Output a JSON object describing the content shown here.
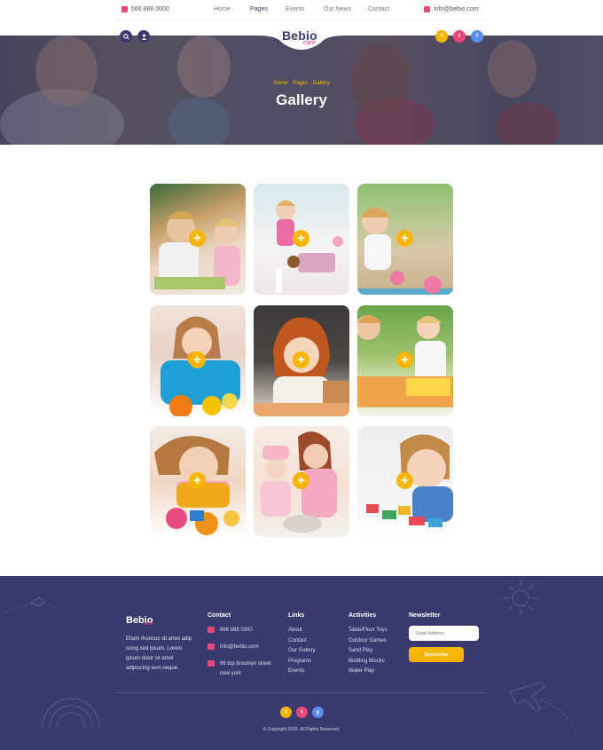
{
  "topbar": {
    "phone": "666 888 0000",
    "email": "info@bebio.com",
    "nav": [
      "Home",
      "Pages",
      "Events",
      "Our News",
      "Contact"
    ],
    "active_nav": "Pages"
  },
  "brand": {
    "name": "Bebio",
    "tag": "care"
  },
  "hero": {
    "breadcrumb": [
      "Home",
      "Pages",
      "Gallery"
    ],
    "title": "Gallery"
  },
  "header_socials": [
    "f",
    "t",
    "f"
  ],
  "gallery": {
    "plus_label": "+",
    "items": [
      {
        "subject": "boys-playing-table"
      },
      {
        "subject": "girl-with-toys"
      },
      {
        "subject": "child-in-sandbox"
      },
      {
        "subject": "girl-with-fruit"
      },
      {
        "subject": "girl-redhair-drawing"
      },
      {
        "subject": "boy-painting-outdoors"
      },
      {
        "subject": "girl-playdough"
      },
      {
        "subject": "mother-cooking-with-child"
      },
      {
        "subject": "boy-building-blocks"
      }
    ]
  },
  "footer": {
    "about": "Etiam rhoncus sit amet adip scing sed ipsum. Lorem ipsum dolor sit amet adipiscing sem neque.",
    "contact": {
      "title": "Contact",
      "phone": "666 888 0000",
      "email": "info@bebio.com",
      "address": "66 top brooklyn street new york"
    },
    "links": {
      "title": "Links",
      "items": [
        "About",
        "Contact",
        "Our Gallery",
        "Programs",
        "Events"
      ]
    },
    "activities": {
      "title": "Activities",
      "items": [
        "Table/Floor Toys",
        "Outdoor Games",
        "Sand Play",
        "Building Blocks",
        "Water Play"
      ]
    },
    "newsletter": {
      "title": "Newsletter",
      "placeholder": "Email Address",
      "button": "Subscribe"
    },
    "socials": [
      "f",
      "t",
      "y"
    ],
    "copyright": "© Copyright 2020. All Rights Reserved."
  },
  "colors": {
    "navy": "#3a3970",
    "pink": "#e9467a",
    "yellow": "#f7b500",
    "blue": "#5b8def"
  }
}
